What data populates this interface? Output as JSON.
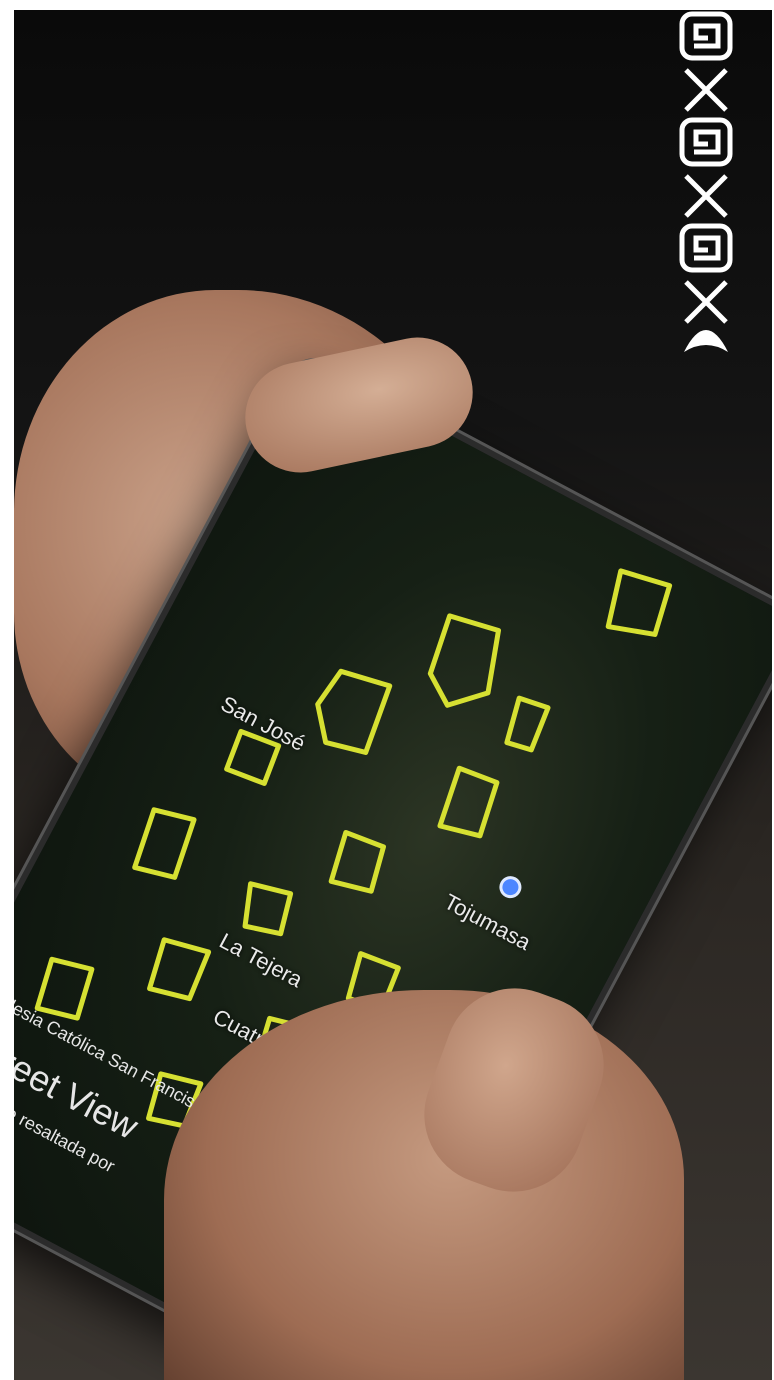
{
  "map": {
    "labels": {
      "san_jose": "San José",
      "tojumasa": "Tojumasa",
      "la_tejera": "La Tejera",
      "cuatro_caminos": "Cuatro Caminos"
    }
  },
  "bottom_sheet": {
    "place_name": "Iglesia Católica San Francisco de Asís",
    "title": "Street View",
    "subtitle": "una calle resaltada por"
  },
  "icons": {
    "logo": "maze-spiral-x-logo",
    "location_pin": "location-pin-icon"
  },
  "colors": {
    "highlight": "#d6e032",
    "pin": "#4d86ff"
  }
}
